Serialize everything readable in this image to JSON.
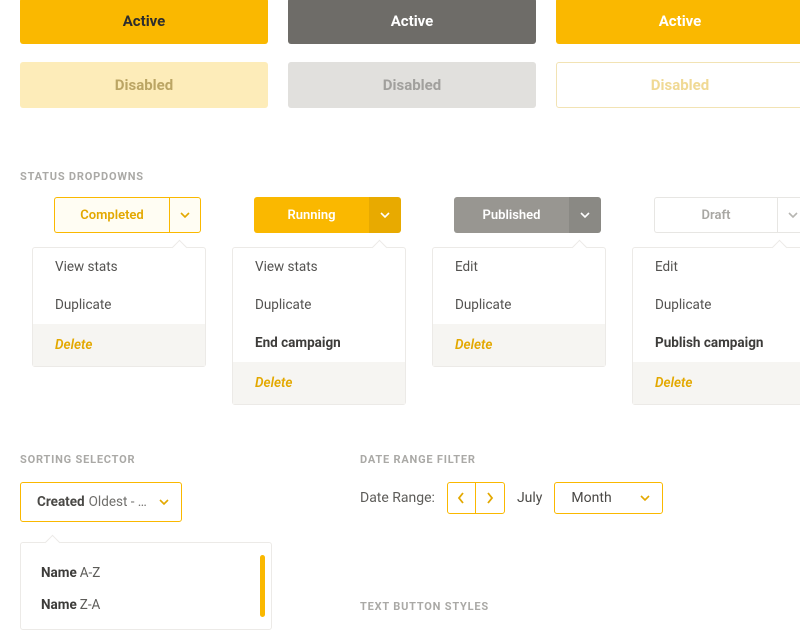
{
  "buttons": {
    "active": "Active",
    "disabled": "Disabled"
  },
  "sections": {
    "status_dropdowns": "STATUS DROPDOWNS",
    "sorting_selector": "SORTING SELECTOR",
    "date_range_filter": "DATE RANGE FILTER",
    "text_button_styles": "TEXT BUTTON STYLES"
  },
  "status": {
    "completed": {
      "label": "Completed",
      "items": [
        "View stats",
        "Duplicate"
      ],
      "delete": "Delete"
    },
    "running": {
      "label": "Running",
      "items": [
        "View stats",
        "Duplicate",
        "End campaign"
      ],
      "delete": "Delete"
    },
    "published": {
      "label": "Published",
      "items": [
        "Edit",
        "Duplicate"
      ],
      "delete": "Delete"
    },
    "draft": {
      "label": "Draft",
      "items": [
        "Edit",
        "Duplicate",
        "Publish campaign"
      ],
      "delete": "Delete"
    }
  },
  "sort": {
    "field": "Created",
    "order": "Oldest - …",
    "options": [
      {
        "field": "Name",
        "order": "A-Z"
      },
      {
        "field": "Name",
        "order": "Z-A"
      }
    ]
  },
  "date": {
    "label": "Date Range:",
    "current": "July",
    "unit": "Month"
  }
}
